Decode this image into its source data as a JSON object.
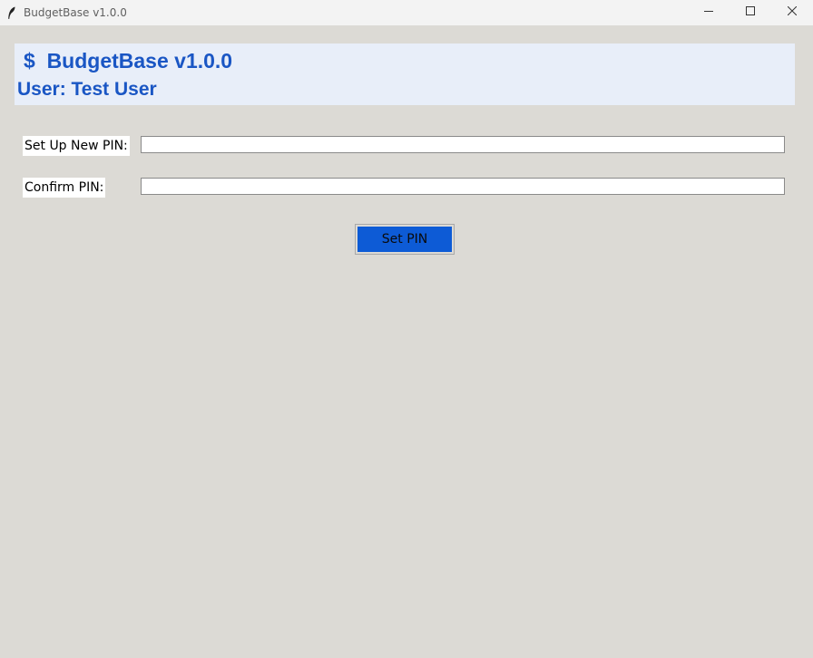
{
  "window": {
    "title": "BudgetBase v1.0.0"
  },
  "header": {
    "app_title": "$  BudgetBase v1.0.0",
    "user_line": "User: Test User"
  },
  "form": {
    "new_pin_label": "Set Up New PIN:",
    "new_pin_value": "",
    "confirm_pin_label": "Confirm PIN:",
    "confirm_pin_value": "",
    "submit_label": "Set PIN"
  },
  "colors": {
    "accent": "#1a56c4",
    "button": "#0d5bd6",
    "header_bg": "#e8eef9",
    "window_bg": "#dcdad5"
  },
  "icons": {
    "app": "feather-icon",
    "minimize": "minimize-icon",
    "maximize": "maximize-icon",
    "close": "close-icon"
  }
}
